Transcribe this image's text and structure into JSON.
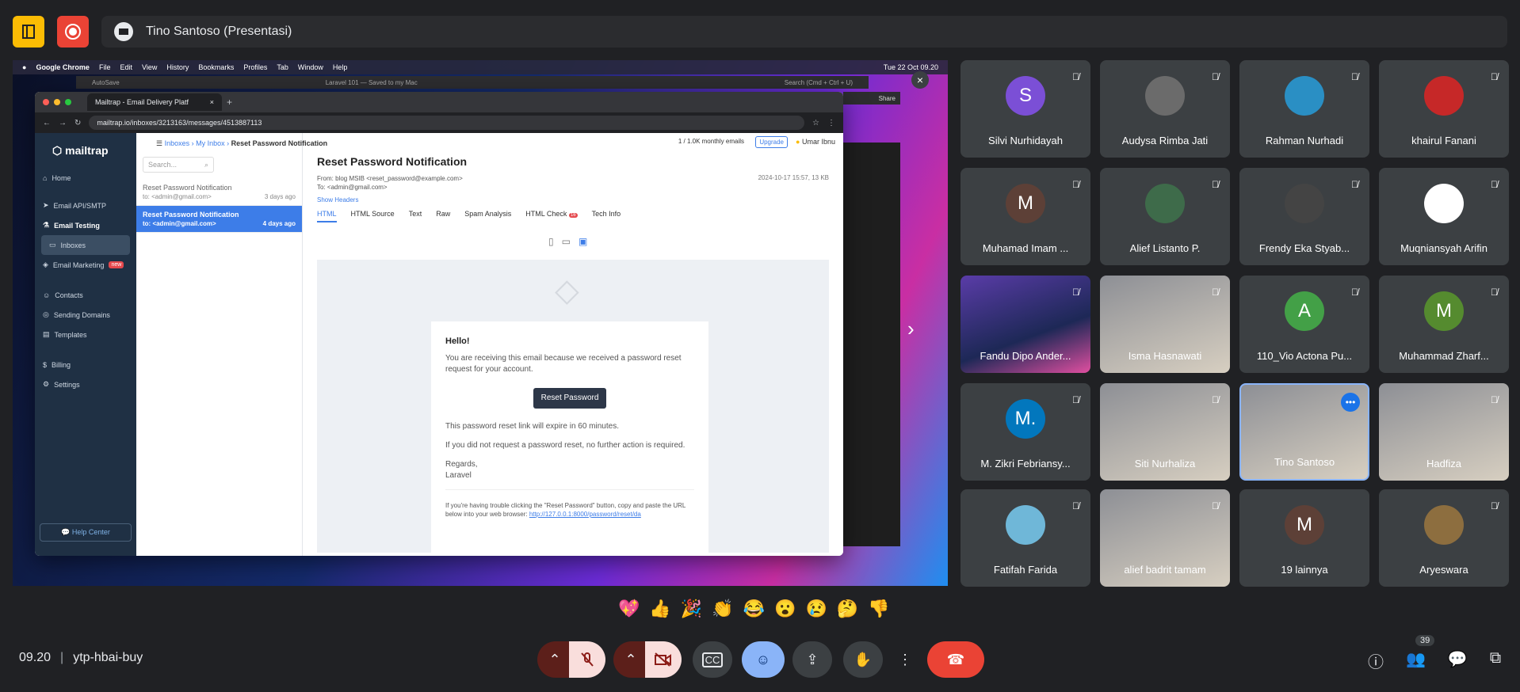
{
  "presenter": {
    "label": "Tino Santoso (Presentasi)"
  },
  "meeting": {
    "time": "09.20",
    "code": "ytp-hbai-buy"
  },
  "mac_menu": {
    "items": [
      "Google Chrome",
      "File",
      "Edit",
      "View",
      "History",
      "Bookmarks",
      "Profiles",
      "Tab",
      "Window",
      "Help"
    ],
    "clock": "Tue 22 Oct 09.20",
    "doc_title": "Laravel 101 — Saved to my Mac",
    "search_placeholder": "Search (Cmd + Ctrl + U)",
    "autosave": "AutoSave",
    "share": "Share"
  },
  "browser": {
    "tab_title": "Mailtrap - Email Delivery Platf",
    "url": "mailtrap.io/inboxes/3213163/messages/4513887113"
  },
  "sidebar": {
    "logo": "mailtrap",
    "items": [
      "Home",
      "Email API/SMTP",
      "Email Testing",
      "Inboxes",
      "Email Marketing",
      "Contacts",
      "Sending Domains",
      "Templates",
      "Billing",
      "Settings"
    ],
    "new_badge": "new",
    "help": "Help Center"
  },
  "breadcrumb": {
    "a": "Inboxes",
    "b": "My Inbox",
    "c": "Reset Password Notification"
  },
  "header": {
    "quota": "1 / 1.0K monthly emails",
    "upgrade": "Upgrade",
    "user": "Umar Ibnu"
  },
  "list": {
    "search_placeholder": "Search...",
    "messages": [
      {
        "title": "Reset Password Notification",
        "to": "to: <admin@gmail.com>",
        "date": "3 days ago"
      },
      {
        "title": "Reset Password Notification",
        "to": "to: <admin@gmail.com>",
        "date": "4 days ago"
      }
    ]
  },
  "message": {
    "subject": "Reset Password Notification",
    "from": "From: blog MSIB <reset_password@example.com>",
    "to": "To:  <admin@gmail.com>",
    "date": "2024-10-17 15:57, 13 KB",
    "show_headers": "Show Headers",
    "tabs": [
      "HTML",
      "HTML Source",
      "Text",
      "Raw",
      "Spam Analysis",
      "HTML Check",
      "Tech Info"
    ],
    "html_check_badge": "16"
  },
  "email": {
    "greeting": "Hello!",
    "intro": "You are receiving this email because we received a password reset request for your account.",
    "button": "Reset Password",
    "expire": "This password reset link will expire in 60 minutes.",
    "no_action": "If you did not request a password reset, no further action is required.",
    "regards": "Regards,",
    "sender": "Laravel",
    "trouble": "If you're having trouble clicking the \"Reset Password\" button, copy and paste the URL below into your web browser:",
    "link": "http://127.0.0.1:8000/password/reset/da"
  },
  "participants": [
    {
      "name": "Silvi Nurhidayah",
      "initial": "S",
      "color": "#7b4fd6"
    },
    {
      "name": "Audysa Rimba Jati",
      "initial": "",
      "color": "#6b6b6b"
    },
    {
      "name": "Rahman Nurhadi",
      "initial": "",
      "color": "#2a8fc4"
    },
    {
      "name": "khairul Fanani",
      "initial": "",
      "color": "#c62828"
    },
    {
      "name": "Muhamad Imam ...",
      "initial": "M",
      "color": "#5d4037"
    },
    {
      "name": "Alief Listanto P.",
      "initial": "",
      "color": "#3e6b4a"
    },
    {
      "name": "Frendy Eka Styab...",
      "initial": "",
      "color": "#444444"
    },
    {
      "name": "Muqniansyah Arifin",
      "initial": "",
      "color": "#ffffff"
    },
    {
      "name": "Fandu Dipo Ander...",
      "initial": "",
      "color": ""
    },
    {
      "name": "Isma Hasnawati",
      "initial": "",
      "color": ""
    },
    {
      "name": "110_Vio Actona Pu...",
      "initial": "A",
      "color": "#43a047"
    },
    {
      "name": "Muhammad Zharf...",
      "initial": "M",
      "color": "#558b2f"
    },
    {
      "name": "M. Zikri Febriansy...",
      "initial": "M.",
      "color": "#0277bd"
    },
    {
      "name": "Siti Nurhaliza",
      "initial": "",
      "color": ""
    },
    {
      "name": "Tino Santoso",
      "initial": "",
      "color": ""
    },
    {
      "name": "Hadfiza",
      "initial": "",
      "color": ""
    },
    {
      "name": "Fatifah Farida",
      "initial": "",
      "color": "#6fb7d8"
    },
    {
      "name": "alief badrit tamam",
      "initial": "",
      "color": ""
    },
    {
      "name": "19 lainnya",
      "initial": "M",
      "color": "#5d4037"
    },
    {
      "name": "Aryeswara",
      "initial": "",
      "color": "#8d6e3f"
    }
  ],
  "reactions": [
    "💖",
    "👍",
    "🎉",
    "👏",
    "😂",
    "😮",
    "😢",
    "🤔",
    "👎"
  ],
  "people_count": "39",
  "colors": {
    "bg": "#202124",
    "hangup": "#ea4335",
    "danger": "#f28b82",
    "accent": "#8ab4f8"
  }
}
